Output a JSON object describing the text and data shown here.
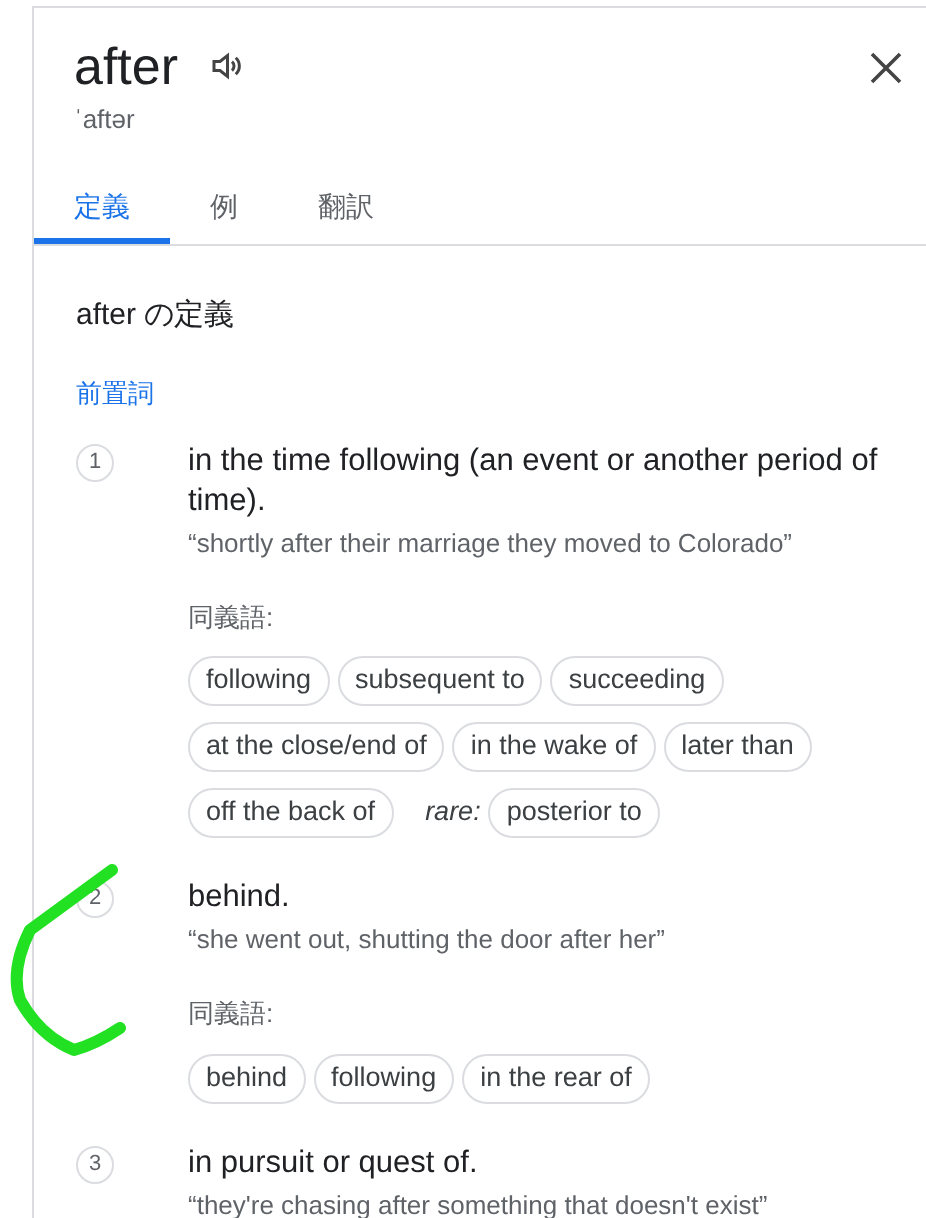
{
  "header": {
    "word": "after",
    "pronunciation": "ˈaftər"
  },
  "tabs": [
    {
      "label": "定義",
      "selected": true
    },
    {
      "label": "例",
      "selected": false
    },
    {
      "label": "翻訳",
      "selected": false
    }
  ],
  "section_title": "after の定義",
  "part_of_speech": "前置詞",
  "senses": [
    {
      "number": "1",
      "definition": "in the time following (an event or another period of time).",
      "example": "“shortly after their marriage they moved to Colorado”",
      "synonyms_label": "同義語:",
      "synonym_rows": [
        [
          {
            "kind": "chip",
            "text": "following"
          },
          {
            "kind": "chip",
            "text": "subsequent to"
          },
          {
            "kind": "chip",
            "text": "succeeding"
          }
        ],
        [
          {
            "kind": "chip",
            "text": "at the close/end of"
          },
          {
            "kind": "chip",
            "text": "in the wake of"
          },
          {
            "kind": "chip",
            "text": "later than"
          }
        ],
        [
          {
            "kind": "chip",
            "text": "off the back of"
          },
          {
            "kind": "label",
            "text": "rare:"
          },
          {
            "kind": "chip",
            "text": "posterior to"
          }
        ]
      ]
    },
    {
      "number": "2",
      "definition": "behind.",
      "example": "“she went out, shutting the door after her”",
      "synonyms_label": "同義語:",
      "synonym_rows": [
        [
          {
            "kind": "chip",
            "text": "behind"
          },
          {
            "kind": "chip",
            "text": "following"
          },
          {
            "kind": "chip",
            "text": "in the rear of"
          }
        ]
      ]
    },
    {
      "number": "3",
      "definition": "in pursuit or quest of.",
      "example": "“they're chasing after something that doesn't exist”"
    }
  ],
  "annotation": {
    "kind": "scribble"
  }
}
